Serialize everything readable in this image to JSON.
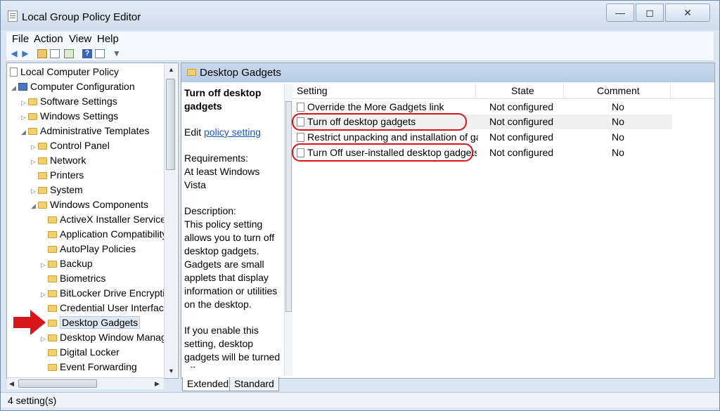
{
  "window": {
    "title": "Local Group Policy Editor",
    "minimize_glyph": "—",
    "maximize_glyph": "◻",
    "close_glyph": "✕"
  },
  "menu": {
    "file": "File",
    "action": "Action",
    "view": "View",
    "help": "Help"
  },
  "toolbar": {
    "icons": [
      "back-icon",
      "forward-icon",
      "up-folder-icon",
      "show-hide-tree-icon",
      "export-list-icon",
      "help-icon",
      "properties-icon",
      "filter-icon"
    ],
    "back_glyph": "◀",
    "forward_glyph": "▶",
    "help_glyph": "?",
    "filter_glyph": "▼"
  },
  "tree": {
    "root": "Local Computer Policy",
    "computer_config": "Computer Configuration",
    "software_settings": "Software Settings",
    "windows_settings": "Windows Settings",
    "admin_templates": "Administrative Templates",
    "control_panel": "Control Panel",
    "network": "Network",
    "printers": "Printers",
    "system": "System",
    "windows_components": "Windows Components",
    "activex": "ActiveX Installer Service",
    "app_compat": "Application Compatibility",
    "autoplay": "AutoPlay Policies",
    "backup": "Backup",
    "biometrics": "Biometrics",
    "bitlocker": "BitLocker Drive Encryption",
    "credential_ui": "Credential User Interface",
    "desktop_gadgets": "Desktop Gadgets",
    "desktop_window_manager": "Desktop Window Manager",
    "digital_locker": "Digital Locker",
    "event_forwarding": "Event Forwarding",
    "expand_glyph": "▷",
    "expanded_glyph": "◢"
  },
  "right_pane": {
    "header": "Desktop Gadgets",
    "description": {
      "title": "Turn off desktop gadgets",
      "edit_prefix": "Edit ",
      "edit_link": "policy setting",
      "requirements_label": "Requirements:",
      "requirements_value": "At least Windows Vista",
      "description_label": "Description:",
      "description_text": "This policy setting allows you to turn off desktop gadgets. Gadgets are small applets that display information or utilities on the  desktop.",
      "if_enable_text": "If you enable this setting, desktop gadgets will be turned off."
    },
    "columns": {
      "setting": "Setting",
      "state": "State",
      "comment": "Comment"
    },
    "rows": [
      {
        "setting": "Override the More Gadgets link",
        "state": "Not configured",
        "comment": "No"
      },
      {
        "setting": "Turn off desktop gadgets",
        "state": "Not configured",
        "comment": "No"
      },
      {
        "setting": "Restrict unpacking and installation of gadgets that are not digitally signed",
        "state": "Not configured",
        "comment": "No"
      },
      {
        "setting": "Turn Off user-installed desktop gadgets",
        "state": "Not configured",
        "comment": "No"
      }
    ]
  },
  "tabs": {
    "extended": "Extended",
    "standard": "Standard"
  },
  "status": {
    "text": "4 setting(s)"
  },
  "colors": {
    "annotation_red": "#d6161b",
    "link_blue": "#1a56c6"
  }
}
